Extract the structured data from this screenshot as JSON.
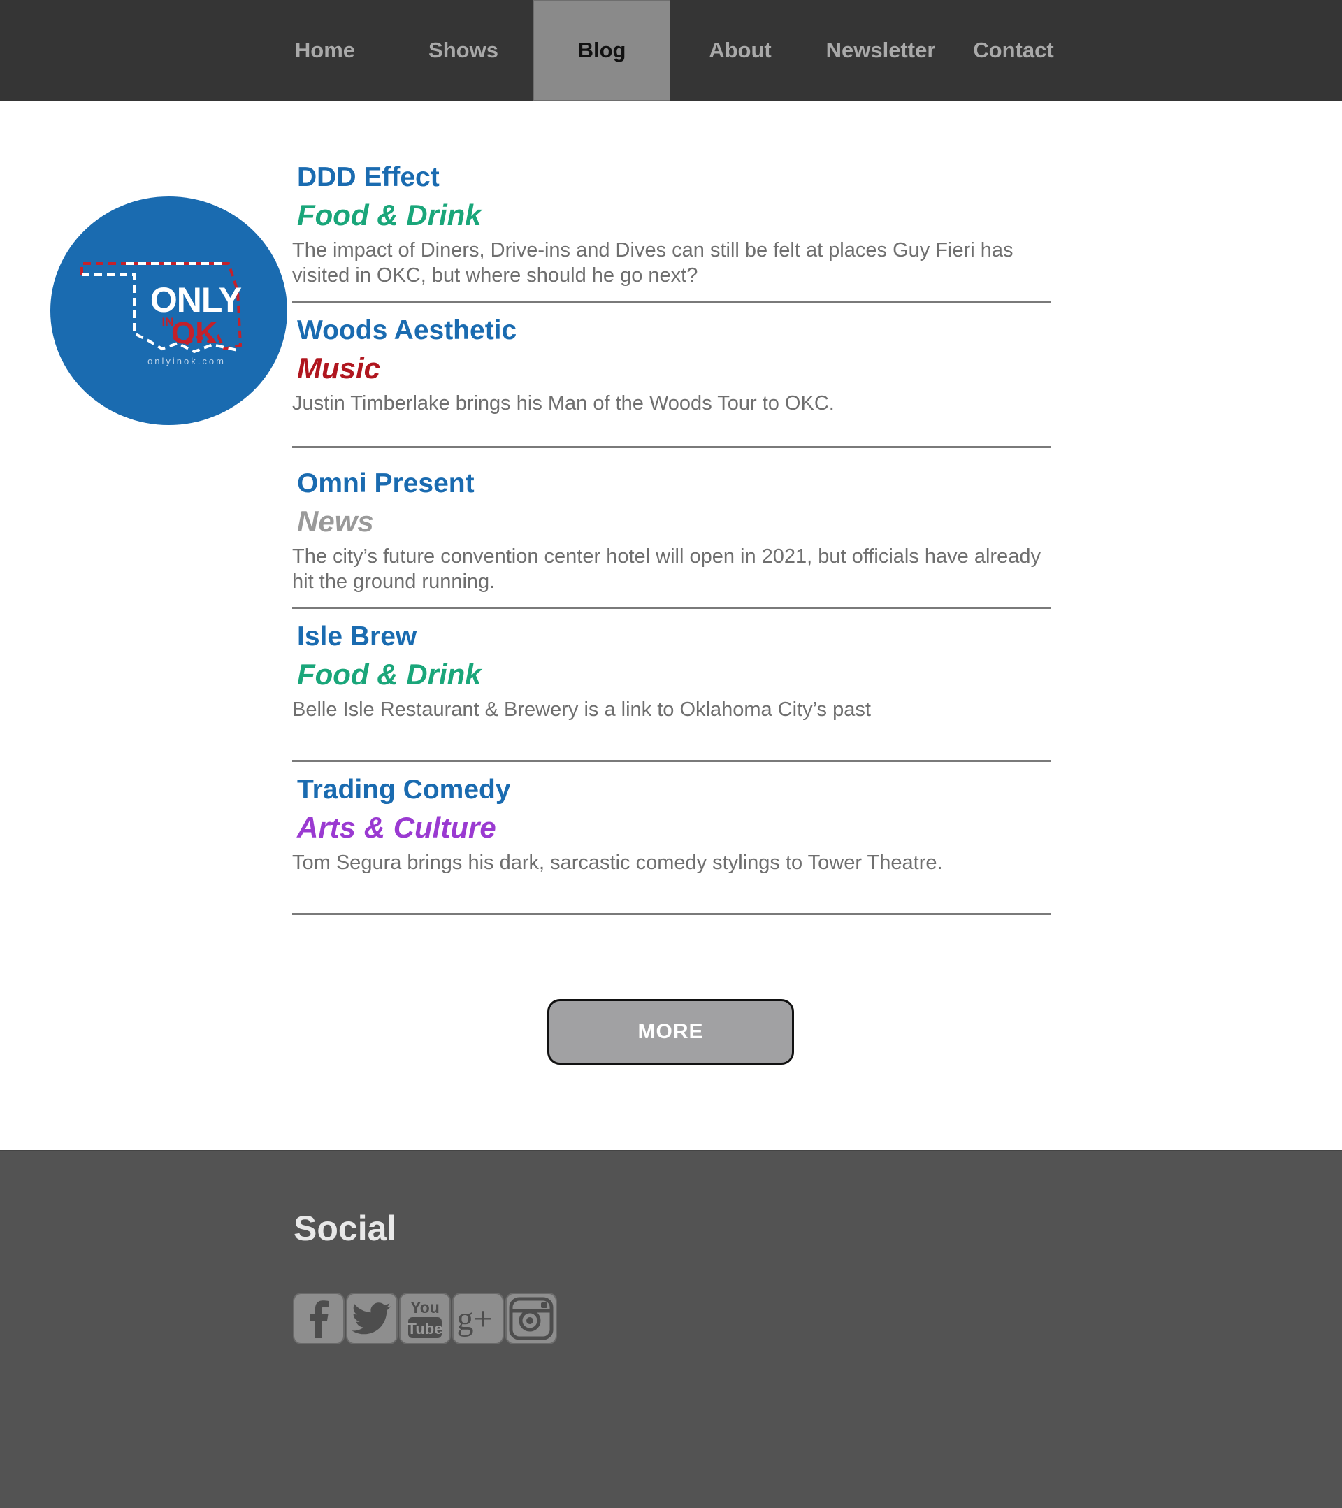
{
  "nav": {
    "items": [
      {
        "label": "Home"
      },
      {
        "label": "Shows"
      },
      {
        "label": "Blog",
        "active": true
      },
      {
        "label": "About"
      },
      {
        "label": "Newsletter"
      },
      {
        "label": "Contact"
      }
    ]
  },
  "logo": {
    "icon": "only-in-ok-logo",
    "text_main": "ONLY",
    "text_in": "IN",
    "text_ok": "OK",
    "url_text": "onlyinok.com"
  },
  "posts": [
    {
      "title": "DDD Effect",
      "category": "Food & Drink",
      "category_color": "#1aa67a",
      "excerpt": "The impact of Diners, Drive-ins and Dives can still be felt at places Guy Fieri has visited in OKC, but where should he go next?"
    },
    {
      "title": "Woods Aesthetic",
      "category": "Music",
      "category_color": "#b0161f",
      "excerpt": "Justin Timberlake brings his Man of the Woods Tour to OKC."
    },
    {
      "title": "Omni Present",
      "category": "News",
      "category_color": "#9a9a9a",
      "excerpt": "The city’s future convention center hotel will open in 2021, but officials have already hit the ground running."
    },
    {
      "title": "Isle Brew",
      "category": "Food & Drink",
      "category_color": "#1aa67a",
      "excerpt": "Belle Isle Restaurant & Brewery is a link to Oklahoma City’s past"
    },
    {
      "title": "Trading Comedy",
      "category": "Arts & Culture",
      "category_color": "#9a3ad1",
      "excerpt": "Tom Segura brings his dark, sarcastic comedy stylings to Tower Theatre."
    }
  ],
  "more_button": {
    "label": "MORE"
  },
  "footer": {
    "social_heading": "Social",
    "social_icons": [
      "facebook-icon",
      "twitter-icon",
      "youtube-icon",
      "google-plus-icon",
      "instagram-icon"
    ],
    "youtube_text_top": "You",
    "youtube_text_bottom": "Tube",
    "google_plus_text": "g+"
  },
  "colors": {
    "nav_bg": "#353535",
    "nav_active_bg": "#8a8a8a",
    "title_blue": "#1a6bb0",
    "logo_blue": "#1a6bb0",
    "logo_red": "#c4212b",
    "footer_bg": "#535353"
  }
}
